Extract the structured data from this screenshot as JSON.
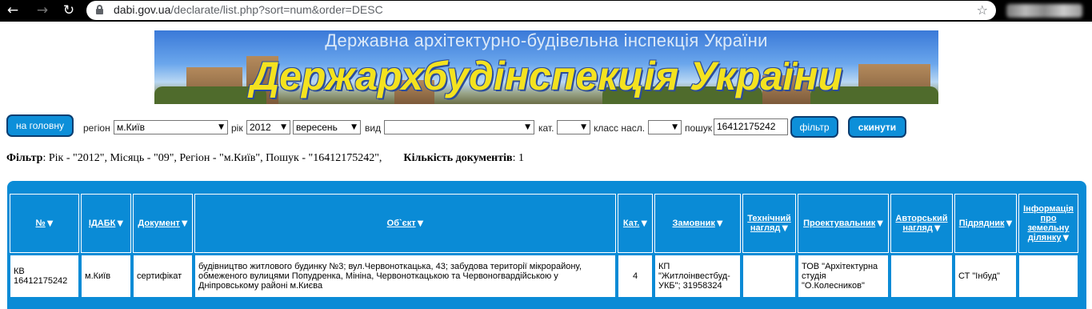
{
  "browser": {
    "url_host": "dabi.gov.ua",
    "url_path": "/declarate/list.php?sort=num&order=DESC"
  },
  "banner": {
    "subtitle": "Державна архітектурно-будівельна інспекція України",
    "title": "Держархбудінспекція України"
  },
  "filters": {
    "home_button": "на головну",
    "region_label": "регіон",
    "region_value": "м.Київ",
    "year_label": "рік",
    "year_value": "2012",
    "month_value": "вересень",
    "type_label": "вид",
    "type_value": "",
    "category_label": "кат.",
    "category_value": "",
    "class_label": "класс насл.",
    "class_value": "",
    "search_label": "пошук",
    "search_value": "16412175242",
    "filter_button": "фільтр",
    "reset_button": "скинути"
  },
  "summary": {
    "filter_label": "Фільтр",
    "filter_text": ": Рік - \"2012\", Місяць - \"09\", Регіон - \"м.Київ\", Пошук - \"16412175242\",",
    "count_label": "Кількість документів",
    "count_value": ": 1"
  },
  "table": {
    "headers": [
      "№",
      "ІДАБК",
      "Документ",
      "Об`єкт",
      "Кат.",
      "Замовник",
      "Технічний нагляд",
      "Проектувальник",
      "Авторський нагляд",
      "Підрядник",
      "Інформація про земельну ділянку"
    ],
    "rows": [
      {
        "num": "КВ 16412175242",
        "idabk": "м.Київ",
        "document": "сертифікат",
        "object": "будівництво житлового будинку №3; вул.Червоноткацька, 43; забудова території мікрорайону, обмеженого вулицями Попудренка, Мініна, Червоноткацькою та Червоногвардійською у Дніпровському районі м.Києва",
        "category": "4",
        "customer": "КП \"Житлоінвестбуд-УКБ\"; 31958324",
        "tech_supervision": "",
        "designer": "ТОВ \"Архітектурна студія \"О.Колесников\"",
        "author_supervision": "",
        "contractor": "СТ \"Інбуд\"",
        "land_info": ""
      }
    ]
  },
  "colors": {
    "accent": "#0a8bd6",
    "button_border": "#0a3d70",
    "banner_title": "#f4e21f"
  }
}
